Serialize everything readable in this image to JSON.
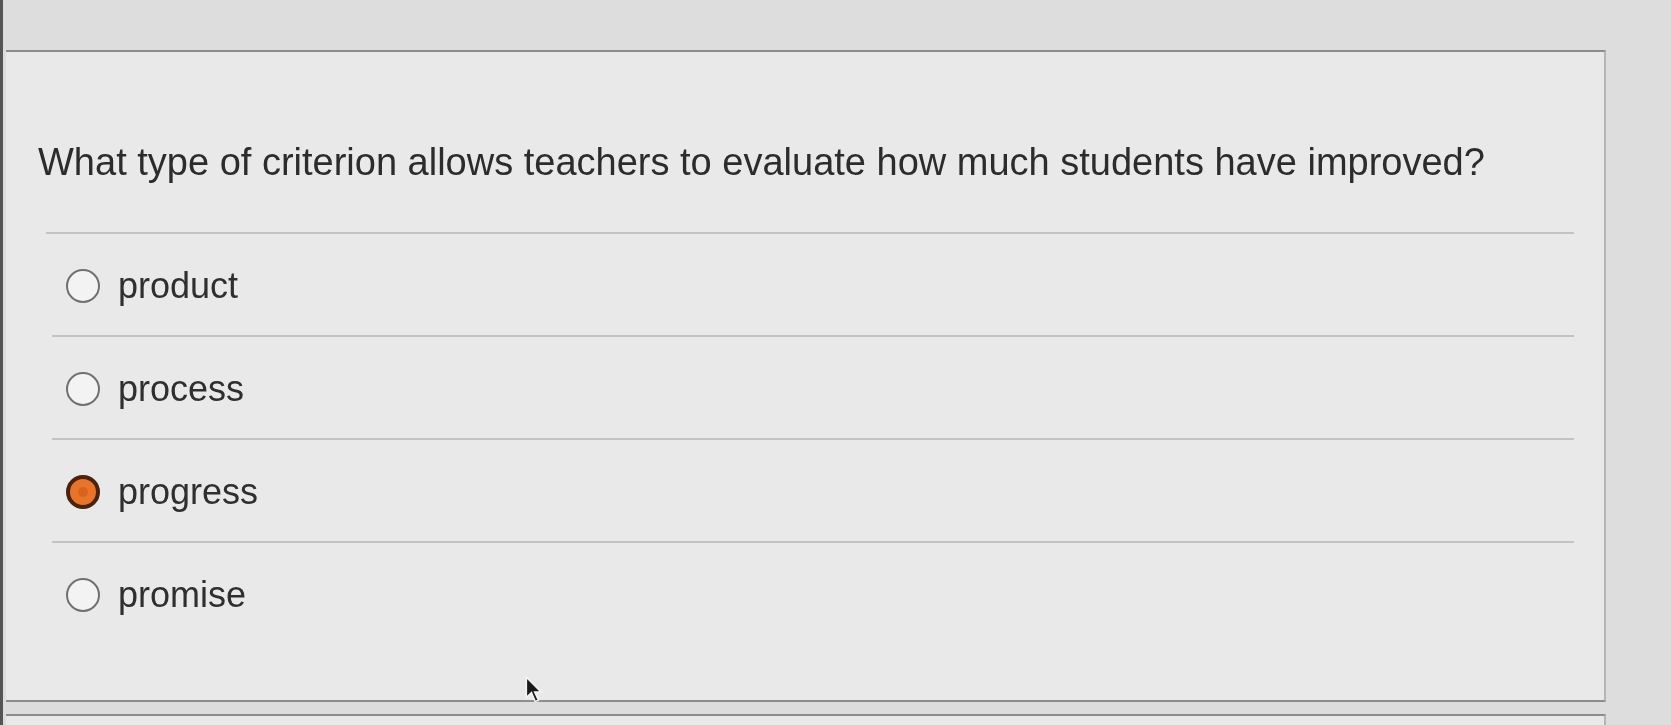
{
  "question": {
    "text": "What type of criterion allows teachers to evaluate how much students have improved?"
  },
  "options": [
    {
      "label": "product",
      "selected": false
    },
    {
      "label": "process",
      "selected": false
    },
    {
      "label": "progress",
      "selected": true
    },
    {
      "label": "promise",
      "selected": false
    }
  ]
}
